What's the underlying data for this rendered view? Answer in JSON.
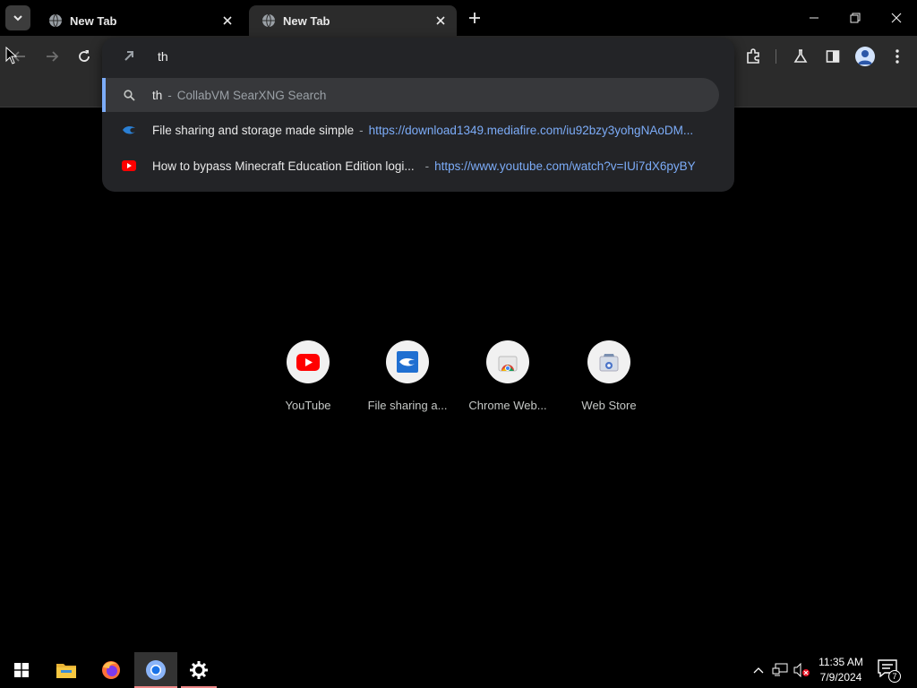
{
  "tabs": [
    {
      "title": "New Tab",
      "active": false
    },
    {
      "title": "New Tab",
      "active": true
    }
  ],
  "omnibox": {
    "value": "th",
    "suggestions": [
      {
        "main": "th",
        "sub": "CollabVM SearXNG Search",
        "icon": "search-icon",
        "selected": true
      },
      {
        "main": "File sharing and storage made simple",
        "url": "https://download1349.mediafire.com/iu92bzy3yohgNAoDM...",
        "icon": "mediafire-icon"
      },
      {
        "main": "How to bypass Minecraft Education Edition logi...",
        "url": "https://www.youtube.com/watch?v=IUi7dX6pyBY",
        "icon": "youtube-icon"
      }
    ]
  },
  "shortcuts": [
    {
      "label": "YouTube",
      "icon": "youtube-icon"
    },
    {
      "label": "File sharing a...",
      "icon": "mediafire-icon"
    },
    {
      "label": "Chrome Web...",
      "icon": "chrome-web-store-icon"
    },
    {
      "label": "Web Store",
      "icon": "web-store-icon"
    }
  ],
  "taskbar": {
    "apps": [
      "start-icon",
      "file-explorer-icon",
      "firefox-icon",
      "chrome-icon",
      "settings-icon"
    ],
    "time": "11:35 AM",
    "date": "7/9/2024",
    "notification_count": "7"
  },
  "colors": {
    "accent": "#7cacf8",
    "toolbar": "#2b2b2b",
    "omnibox_bg": "#232427",
    "selected_row": "#37383b"
  }
}
